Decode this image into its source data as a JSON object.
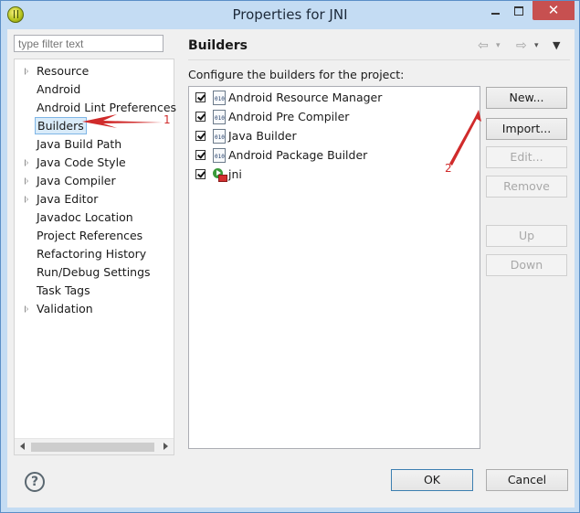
{
  "window": {
    "title": "Properties for JNI"
  },
  "filter": {
    "placeholder": "type filter text"
  },
  "tree": {
    "items": [
      {
        "label": "Resource",
        "expandable": true
      },
      {
        "label": "Android",
        "expandable": false
      },
      {
        "label": "Android Lint Preferences",
        "expandable": false
      },
      {
        "label": "Builders",
        "expandable": false,
        "selected": true
      },
      {
        "label": "Java Build Path",
        "expandable": false
      },
      {
        "label": "Java Code Style",
        "expandable": true
      },
      {
        "label": "Java Compiler",
        "expandable": true
      },
      {
        "label": "Java Editor",
        "expandable": true
      },
      {
        "label": "Javadoc Location",
        "expandable": false
      },
      {
        "label": "Project References",
        "expandable": false
      },
      {
        "label": "Refactoring History",
        "expandable": false
      },
      {
        "label": "Run/Debug Settings",
        "expandable": false
      },
      {
        "label": "Task Tags",
        "expandable": false
      },
      {
        "label": "Validation",
        "expandable": true
      }
    ]
  },
  "pane": {
    "title": "Builders",
    "caption": "Configure the builders for the project:"
  },
  "builders": [
    {
      "label": "Android Resource Manager",
      "checked": true,
      "icon": "binary-file-icon"
    },
    {
      "label": "Android Pre Compiler",
      "checked": true,
      "icon": "binary-file-icon"
    },
    {
      "label": "Java Builder",
      "checked": true,
      "icon": "binary-file-icon"
    },
    {
      "label": "Android Package Builder",
      "checked": true,
      "icon": "binary-file-icon"
    },
    {
      "label": "jni",
      "checked": true,
      "icon": "external-tool-run-icon"
    }
  ],
  "buttons": {
    "new": "New...",
    "import": "Import...",
    "edit": "Edit...",
    "remove": "Remove",
    "up": "Up",
    "down": "Down",
    "ok": "OK",
    "cancel": "Cancel"
  },
  "annotations": {
    "one": "1",
    "two": "2"
  },
  "colors": {
    "annotation": "#d02b2b",
    "titlebar": "#c4dcf3",
    "close": "#c75050"
  }
}
